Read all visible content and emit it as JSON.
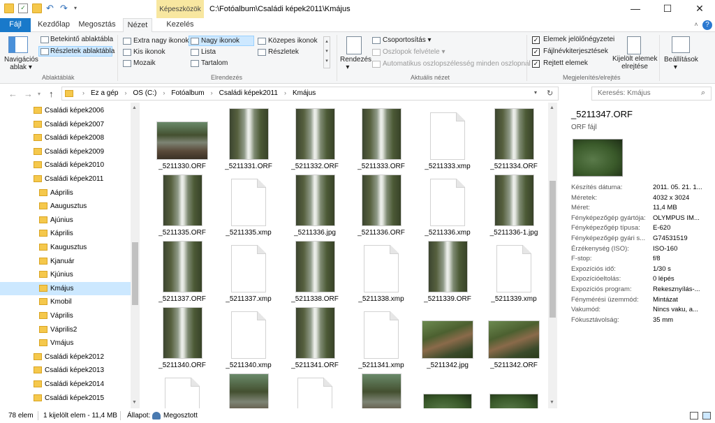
{
  "window": {
    "title": "C:\\Fotóalbum\\Családi képek2011\\Kmájus",
    "context_tab": "Képeszközök"
  },
  "tabs": {
    "file": "Fájl",
    "home": "Kezdőlap",
    "share": "Megosztás",
    "view": "Nézet",
    "manage": "Kezelés"
  },
  "ribbon": {
    "nav_pane": "Navigációs ablak",
    "nav_pane_l1": "Navigációs",
    "nav_pane_l2": "ablak",
    "preview_pane": "Betekintő ablaktábla",
    "details_pane": "Részletek ablaktábla",
    "group_panes": "Ablaktáblák",
    "layout": {
      "xl": "Extra nagy ikonok",
      "large": "Nagy ikonok",
      "medium": "Közepes ikonok",
      "small": "Kis ikonok",
      "list": "Lista",
      "details": "Részletek",
      "tiles": "Mozaik",
      "content": "Tartalom"
    },
    "group_layout": "Elrendezés",
    "sort": "Rendezés",
    "group_by": "Csoportosítás",
    "add_columns": "Oszlopok felvétele",
    "autosize": "Automatikus oszlopszélesség minden oszlopnál",
    "group_current_view": "Aktuális nézet",
    "item_checkboxes": "Elemek jelölőnégyzetei",
    "file_extensions": "Fájlnévkiterjesztések",
    "hidden_items": "Rejtett elemek",
    "hide_selected_l1": "Kijelölt elemek",
    "hide_selected_l2": "elrejtése",
    "group_showhide": "Megjelenítés/elrejtés",
    "options": "Beállítások"
  },
  "address": {
    "crumbs": [
      "Ez a gép",
      "OS (C:)",
      "Fotóalbum",
      "Családi képek2011",
      "Kmájus"
    ],
    "search_placeholder": "Keresés: Kmájus"
  },
  "sidebar": {
    "items": [
      {
        "label": "Családi képek2006",
        "level": 0
      },
      {
        "label": "Családi képek2007",
        "level": 0
      },
      {
        "label": "Családi képek2008",
        "level": 0
      },
      {
        "label": "Családi képek2009",
        "level": 0
      },
      {
        "label": "Családi képek2010",
        "level": 0
      },
      {
        "label": "Családi képek2011",
        "level": 0
      },
      {
        "label": "Aáprilis",
        "level": 1
      },
      {
        "label": "Aaugusztus",
        "level": 1
      },
      {
        "label": "Ajúnius",
        "level": 1
      },
      {
        "label": "Káprilis",
        "level": 1
      },
      {
        "label": "Kaugusztus",
        "level": 1
      },
      {
        "label": "Kjanuár",
        "level": 1
      },
      {
        "label": "Kjúnius",
        "level": 1
      },
      {
        "label": "Kmájus",
        "level": 1,
        "selected": true
      },
      {
        "label": "Kmobil",
        "level": 1
      },
      {
        "label": "Váprilis",
        "level": 1
      },
      {
        "label": "Váprilis2",
        "level": 1
      },
      {
        "label": "Vmájus",
        "level": 1
      },
      {
        "label": "Családi képek2012",
        "level": 0
      },
      {
        "label": "Családi képek2013",
        "level": 0
      },
      {
        "label": "Családi képek2014",
        "level": 0
      },
      {
        "label": "Családi képek2015",
        "level": 0
      }
    ]
  },
  "files": [
    {
      "name": "_5211330.ORF",
      "kind": "landscape"
    },
    {
      "name": "_5211331.ORF",
      "kind": "waterfall"
    },
    {
      "name": "_5211332.ORF",
      "kind": "waterfall"
    },
    {
      "name": "_5211333.ORF",
      "kind": "waterfall"
    },
    {
      "name": "_5211333.xmp",
      "kind": "doc"
    },
    {
      "name": "_5211334.ORF",
      "kind": "waterfall"
    },
    {
      "name": "_5211335.ORF",
      "kind": "waterfall"
    },
    {
      "name": "_5211335.xmp",
      "kind": "doc"
    },
    {
      "name": "_5211336.jpg",
      "kind": "waterfall"
    },
    {
      "name": "_5211336.ORF",
      "kind": "waterfall"
    },
    {
      "name": "_5211336.xmp",
      "kind": "doc"
    },
    {
      "name": "_5211336-1.jpg",
      "kind": "waterfall"
    },
    {
      "name": "_5211337.ORF",
      "kind": "waterfall"
    },
    {
      "name": "_5211337.xmp",
      "kind": "doc"
    },
    {
      "name": "_5211338.ORF",
      "kind": "waterfall"
    },
    {
      "name": "_5211338.xmp",
      "kind": "doc"
    },
    {
      "name": "_5211339.ORF",
      "kind": "waterfall"
    },
    {
      "name": "_5211339.xmp",
      "kind": "doc"
    },
    {
      "name": "_5211340.ORF",
      "kind": "waterfall"
    },
    {
      "name": "_5211340.xmp",
      "kind": "doc"
    },
    {
      "name": "_5211341.ORF",
      "kind": "waterfall"
    },
    {
      "name": "_5211341.xmp",
      "kind": "doc"
    },
    {
      "name": "_5211342.jpg",
      "kind": "bridge"
    },
    {
      "name": "_5211342.ORF",
      "kind": "bridge"
    },
    {
      "name": "",
      "kind": "doc"
    },
    {
      "name": "",
      "kind": "waterfall2"
    },
    {
      "name": "",
      "kind": "doc"
    },
    {
      "name": "",
      "kind": "waterfall2"
    },
    {
      "name": "",
      "kind": "leaf"
    },
    {
      "name": "",
      "kind": "leaf"
    }
  ],
  "details": {
    "filename": "_5211347.ORF",
    "filetype": "ORF fájl",
    "props": [
      {
        "label": "Készítés dátuma:",
        "value": "2011. 05. 21. 1..."
      },
      {
        "label": "Méretek:",
        "value": "4032 x 3024"
      },
      {
        "label": "Méret:",
        "value": "11,4 MB"
      },
      {
        "label": "Fényképezőgép gyártója:",
        "value": "OLYMPUS IM..."
      },
      {
        "label": "Fényképezőgép típusa:",
        "value": "E-620"
      },
      {
        "label": "Fényképezőgép gyári s...",
        "value": "G74531519"
      },
      {
        "label": "Érzékenység (ISO):",
        "value": "ISO-160"
      },
      {
        "label": "F-stop:",
        "value": "f/8"
      },
      {
        "label": "Expozíciós idő:",
        "value": "1/30 s"
      },
      {
        "label": "Expozícióeltolás:",
        "value": "0 lépés"
      },
      {
        "label": "Expozíciós program:",
        "value": "Rekesznyílás-..."
      },
      {
        "label": "Fénymérési üzemmód:",
        "value": "Mintázat"
      },
      {
        "label": "Vakumód:",
        "value": "Nincs vaku, a..."
      },
      {
        "label": "Fókusztávolság:",
        "value": "35 mm"
      }
    ]
  },
  "status": {
    "count": "78 elem",
    "selected": "1 kijelölt elem - 11,4 MB",
    "state_label": "Állapot:",
    "state_value": "Megosztott"
  }
}
